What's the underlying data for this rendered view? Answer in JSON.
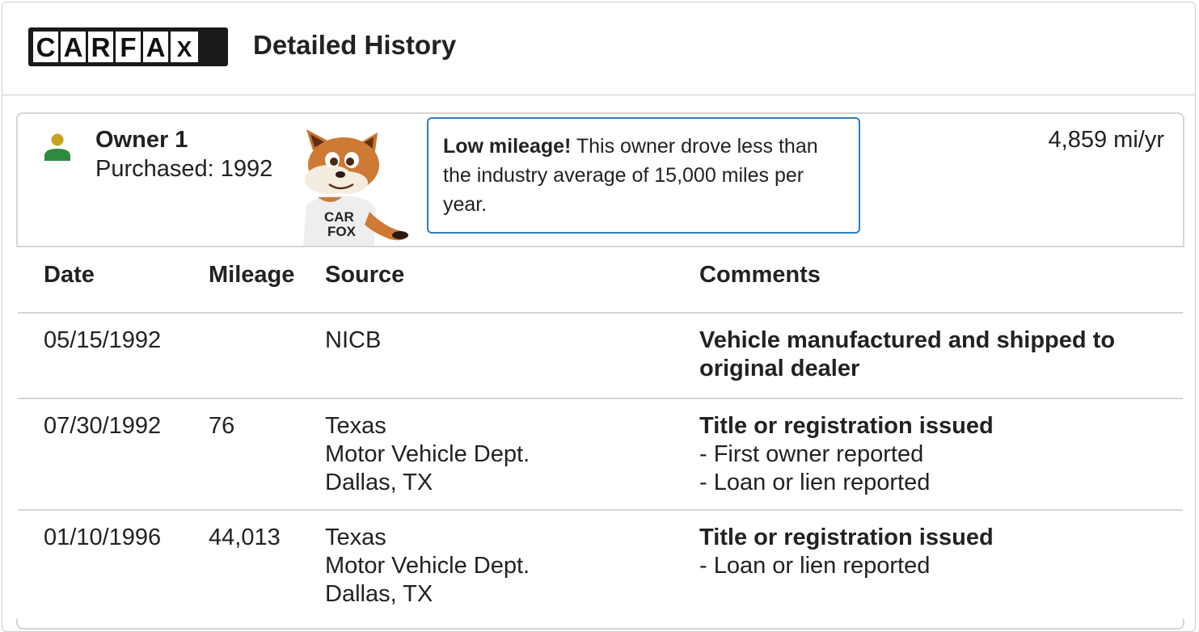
{
  "header": {
    "logo_letters": [
      "C",
      "A",
      "R",
      "F",
      "A",
      "X"
    ],
    "title": "Detailed History"
  },
  "owner": {
    "name": "Owner 1",
    "purchased": "Purchased: 1992",
    "icon": "person-icon",
    "mascot": "carfox-mascot",
    "mascot_shirt": [
      "CAR",
      "FOX"
    ],
    "callout_bold": "Low mileage!",
    "callout_text": " This owner drove less than the industry average of 15,000 miles per year.",
    "mileage_rate": "4,859 mi/yr"
  },
  "table": {
    "headers": [
      "Date",
      "Mileage",
      "Source",
      "Comments"
    ],
    "rows": [
      {
        "date": "05/15/1992",
        "mileage": "",
        "source": [
          "NICB"
        ],
        "comment_title": "Vehicle manufactured and shipped to original dealer",
        "comment_items": []
      },
      {
        "date": "07/30/1992",
        "mileage": "76",
        "source": [
          "Texas",
          "Motor Vehicle Dept.",
          "Dallas, TX"
        ],
        "comment_title": "Title or registration issued",
        "comment_items": [
          "- First owner reported",
          "- Loan or lien reported"
        ]
      },
      {
        "date": "01/10/1996",
        "mileage": "44,013",
        "source": [
          "Texas",
          "Motor Vehicle Dept.",
          "Dallas, TX"
        ],
        "comment_title": "Title or registration issued",
        "comment_items": [
          "- Loan or lien reported"
        ]
      }
    ]
  },
  "colors": {
    "accent_blue": "#2d7fc1",
    "icon_gold": "#c8a21e",
    "icon_green": "#2e8b3d"
  }
}
